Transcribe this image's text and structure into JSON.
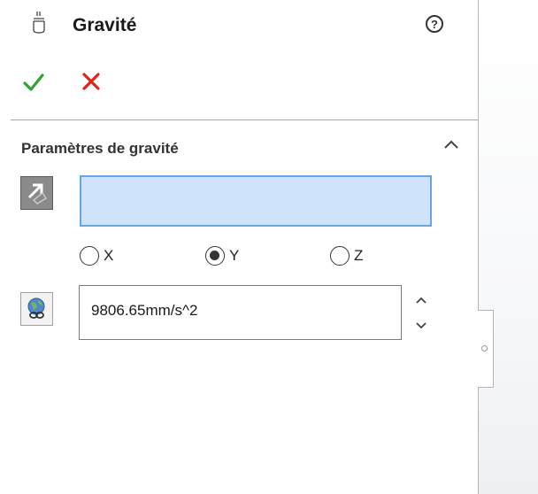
{
  "header": {
    "title": "Gravité",
    "help_label": "?",
    "title_icon": "gravity-feature-icon",
    "ok_icon": "checkmark-icon",
    "cancel_icon": "close-icon"
  },
  "section": {
    "title": "Paramètres de gravité",
    "collapse_icon": "chevron-up-icon",
    "direction_selection": {
      "value": "",
      "icon": "direction-reference-icon"
    },
    "axes": {
      "selected": "Y",
      "options": [
        {
          "label": "X",
          "checked": false
        },
        {
          "label": "Y",
          "checked": true
        },
        {
          "label": "Z",
          "checked": false
        }
      ]
    },
    "magnitude": {
      "value": "9806.65mm/s^2",
      "icon": "globe-link-icon",
      "spin_up_icon": "chevron-up-icon",
      "spin_down_icon": "chevron-down-icon"
    }
  },
  "colors": {
    "ok_green": "#2fa52f",
    "cancel_red": "#e0241c",
    "selection_fill": "#cfe3fb",
    "selection_border": "#6aa4e6"
  }
}
